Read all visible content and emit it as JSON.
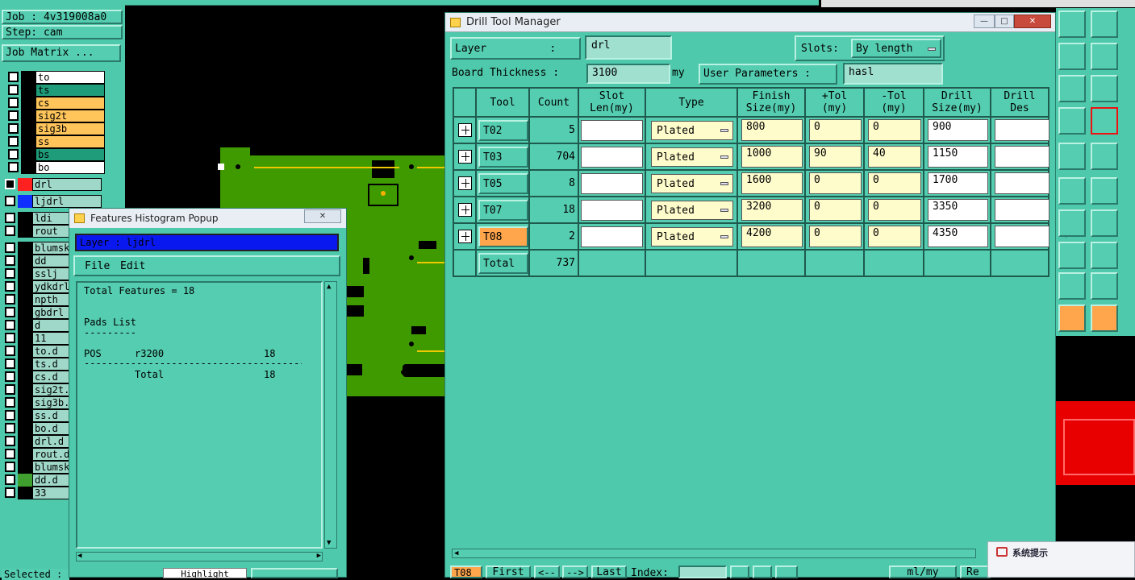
{
  "left_panel": {
    "job": "Job : 4v319008a0",
    "step": "Step: cam",
    "job_matrix": "Job Matrix ...",
    "layers": [
      {
        "name": "to",
        "color": "#ffffff"
      },
      {
        "name": "ts",
        "color": "#1f9c79"
      },
      {
        "name": "cs",
        "color": "#ffc55a"
      },
      {
        "name": "sig2t",
        "color": "#ffc55a"
      },
      {
        "name": "sig3b",
        "color": "#ffc55a"
      },
      {
        "name": "ss",
        "color": "#ffc55a"
      },
      {
        "name": "bs",
        "color": "#1f9c79"
      },
      {
        "name": "bo",
        "color": "#ffffff"
      }
    ],
    "drill_layers": [
      {
        "name": "drl",
        "swatch": "#ff2020"
      },
      {
        "name": "ljdrl",
        "swatch": "#1030ff"
      }
    ],
    "other_layers": [
      "ldi",
      "rout"
    ],
    "misc_layers": [
      "blumsk",
      "dd",
      "sslj",
      "ydkdrl",
      "npth",
      "gbdrl",
      "d",
      "11",
      "to.d",
      "ts.d",
      "cs.d",
      "sig2t.",
      "sig3b.",
      "ss.d",
      "bo.d",
      "drl.d",
      "rout.d",
      "blumsk",
      "dd.d",
      "33"
    ],
    "selected": "Selected :"
  },
  "drill_manager": {
    "title": "Drill Tool Manager",
    "layer_label": "Layer          :",
    "layer_value": "drl",
    "slots_label": "Slots:",
    "slots_value": "By length",
    "board_thickness_label": "Board Thickness :",
    "board_thickness_value": "3100",
    "board_thickness_unit": "my",
    "user_params_label": "User Parameters :",
    "user_params_value": "hasl",
    "headers": [
      "Tool",
      "Count",
      "Slot\nLen(my)",
      "Type",
      "Finish\nSize(my)",
      "+Tol\n(my)",
      "-Tol\n(my)",
      "Drill\nSize(my)",
      "Drill\nDes"
    ],
    "rows": [
      {
        "tool": "T02",
        "count": "5",
        "slot": "",
        "type": "Plated",
        "finish": "800",
        "ptol": "0",
        "ntol": "0",
        "drill": "900",
        "des": ""
      },
      {
        "tool": "T03",
        "count": "704",
        "slot": "",
        "type": "Plated",
        "finish": "1000",
        "ptol": "90",
        "ntol": "40",
        "drill": "1150",
        "des": ""
      },
      {
        "tool": "T05",
        "count": "8",
        "slot": "",
        "type": "Plated",
        "finish": "1600",
        "ptol": "0",
        "ntol": "0",
        "drill": "1700",
        "des": ""
      },
      {
        "tool": "T07",
        "count": "18",
        "slot": "",
        "type": "Plated",
        "finish": "3200",
        "ptol": "0",
        "ntol": "0",
        "drill": "3350",
        "des": ""
      },
      {
        "tool": "T08",
        "count": "2",
        "slot": "",
        "type": "Plated",
        "finish": "4200",
        "ptol": "0",
        "ntol": "0",
        "drill": "4350",
        "des": ""
      }
    ],
    "total_label": "Total",
    "total_value": "737",
    "bottom": {
      "tool": "T08",
      "first": "First",
      "prev": "<--",
      "next": "-->",
      "last": "Last",
      "index": "Index:",
      "units": "ml/my",
      "re": "Re"
    }
  },
  "histogram": {
    "title": "Features Histogram Popup",
    "layer": "Layer :  ljdrl",
    "menu_file": "File",
    "menu_edit": "Edit",
    "total_features": "Total Features = 18",
    "pads_list": "Pads List",
    "dashes": "---------",
    "row_pos": "POS",
    "row_sym": "r3200",
    "row_count": "18",
    "long_dashes": "---------------------------------------",
    "total_label": "Total",
    "total_count": "18",
    "highlight": "Highlight"
  },
  "system_popup": {
    "title": "系统提示"
  }
}
